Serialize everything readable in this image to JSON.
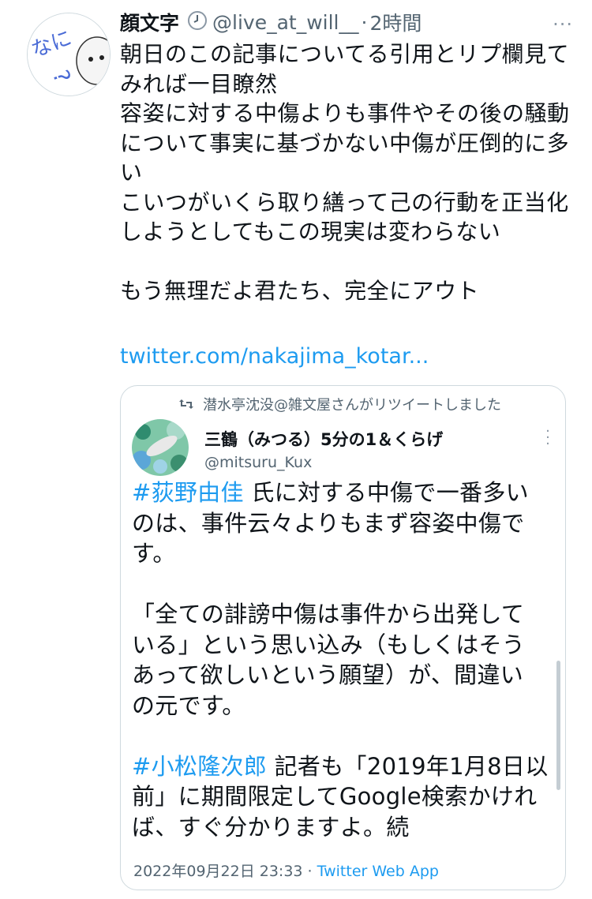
{
  "tweet": {
    "display_name": "顔文字",
    "handle": "@live_at_will__",
    "separator": "·",
    "time": "2時間",
    "avatar_text": "なに?",
    "text": "朝日のこの記事についてる引用とリプ欄見て\nみれば一目瞭然\n容姿に対する中傷よりも事件やその後の騒動\nについて事実に基づかない中傷が圧倒的に多\nい\nこいつがいくら取り繕って己の行動を正当化\nしようとしてもこの現実は変わらない\n\nもう無理だよ君たち、完全にアウト",
    "link": "twitter.com/nakajima_kotar...",
    "more_icon": "..."
  },
  "quoted": {
    "retweet_notice": "潜水亭沈没@雑文屋さんがリツイートしました",
    "display_name": "三鶴（みつる）5分の1＆くらげ",
    "handle": "@mitsuru_Kux",
    "hashtag1": "#荻野由佳",
    "text1": " 氏に対する中傷で一番多い\nのは、事件云々よりもまず容姿中傷で\nす。\n\n「全ての誹謗中傷は事件から出発して\nいる」という思い込み（もしくはそう\nあって欲しいという願望）が、間違い\nの元です。\n\n",
    "hashtag2": "#小松隆次郎",
    "text2": " 記者も「2019年1月8日以\n前」に期間限定してGoogle検索かけれ\nば、すぐ分かりますよ。続",
    "date": "2022年09月22日 23:33",
    "date_separator": " · ",
    "via": "Twitter Web App"
  },
  "icons": [
    "clock-icon",
    "retweet-icon",
    "more-icon"
  ],
  "colors": {
    "link": "#1d9bf0",
    "secondary": "#536471",
    "border": "#cfd9de"
  }
}
